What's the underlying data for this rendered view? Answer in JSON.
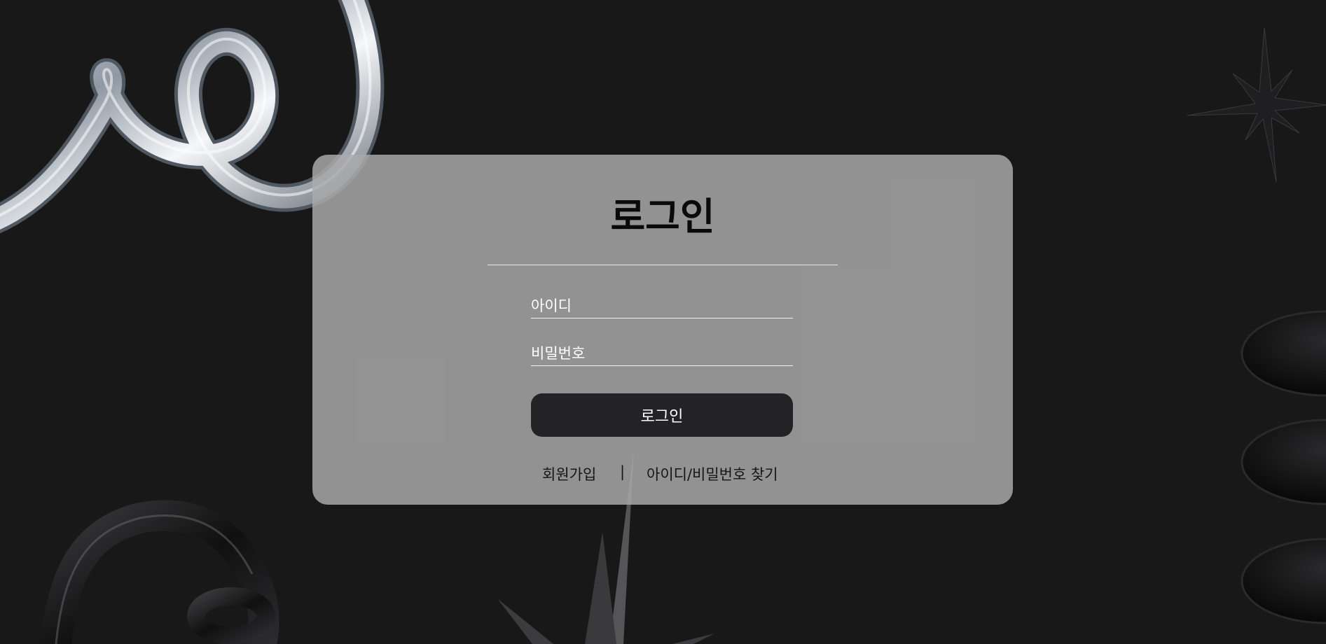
{
  "login": {
    "title": "로그인",
    "id_placeholder": "아이디",
    "password_placeholder": "비밀번호",
    "submit_label": "로그인"
  },
  "links": {
    "signup": "회원가입",
    "separator": "|",
    "find_account": "아이디/비밀번호 찾기"
  },
  "colors": {
    "page_background": "#181818",
    "card_background": "#aaaaaa",
    "button_background": "#232325",
    "button_text": "#ffffff"
  }
}
